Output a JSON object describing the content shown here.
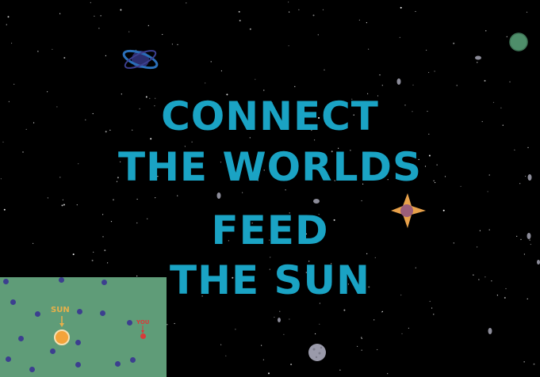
{
  "title": {
    "line1": "CONNECT",
    "line2": "THE WORLDS",
    "line3": "FEED",
    "line4": "THE SUN"
  },
  "minimap": {
    "sun_label": "SUN",
    "you_label": "YOU"
  },
  "colors": {
    "background": "#000000",
    "title_text": "#1aa3c4",
    "minimap_bg": "#5f9c78",
    "minimap_planet": "#3c3f8f",
    "sun": "#f3a33a",
    "sun_label": "#e8b04a",
    "you_marker": "#d83a3a"
  },
  "objects": {
    "ringed_planet": "ringed-planet-icon",
    "green_planet": "green-planet-icon",
    "star_planet": "star-planet-icon",
    "grey_moon": "grey-moon-icon",
    "asteroids": "asteroid-icon"
  }
}
